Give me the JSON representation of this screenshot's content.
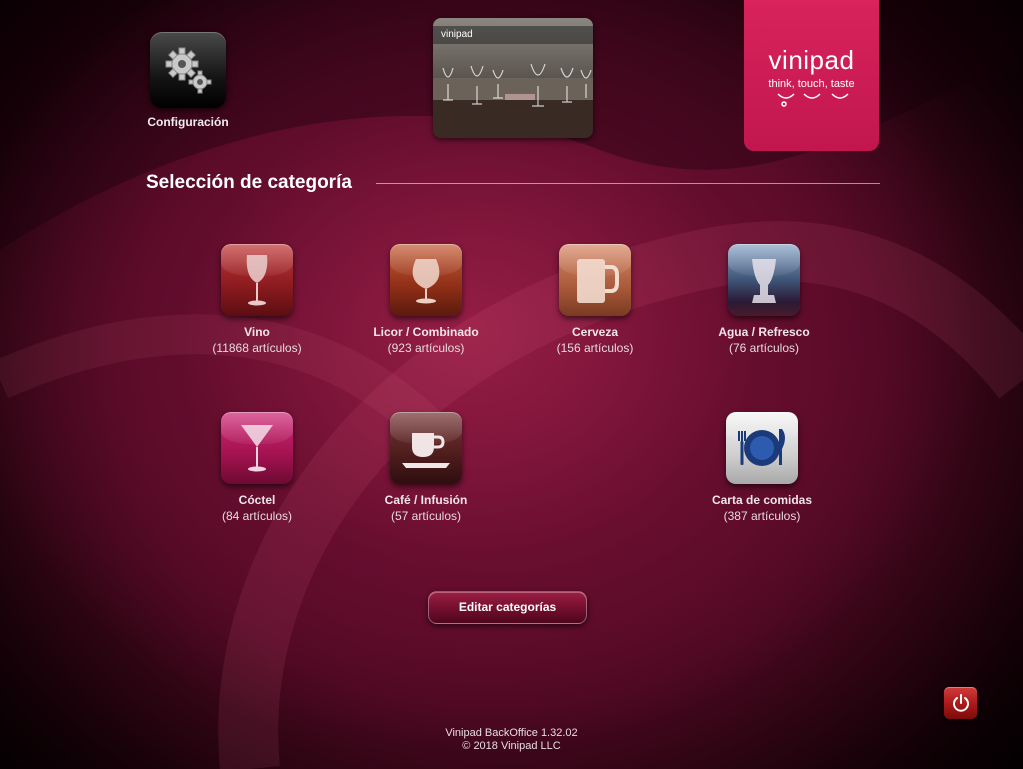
{
  "config": {
    "label": "Configuración"
  },
  "banner": {
    "brand": "vinipad"
  },
  "logo": {
    "name": "vinipad",
    "tagline": "think, touch, taste"
  },
  "heading": "Selección de categoría",
  "categories": [
    {
      "name": "Vino",
      "count": "(11868 artículos)",
      "icon": "wine-glass-icon"
    },
    {
      "name": "Licor / Combinado",
      "count": "(923 artículos)",
      "icon": "snifter-glass-icon"
    },
    {
      "name": "Cerveza",
      "count": "(156 artículos)",
      "icon": "beer-mug-icon"
    },
    {
      "name": "Agua / Refresco",
      "count": "(76 artículos)",
      "icon": "water-glass-icon"
    },
    {
      "name": "Cóctel",
      "count": "(84 artículos)",
      "icon": "cocktail-glass-icon"
    },
    {
      "name": "Café / Infusión",
      "count": "(57 artículos)",
      "icon": "coffee-cup-icon"
    },
    {
      "name": "Carta de comidas",
      "count": "(387 artículos)",
      "icon": "plate-cutlery-icon"
    }
  ],
  "edit_button": "Editar categorías",
  "footer": {
    "version": "Vinipad BackOffice 1.32.02",
    "copyright": "© 2018 Vinipad LLC"
  },
  "colors": {
    "brand_pink": "#d8235c",
    "background": "#6e0d2c",
    "power_red": "#c02020"
  }
}
